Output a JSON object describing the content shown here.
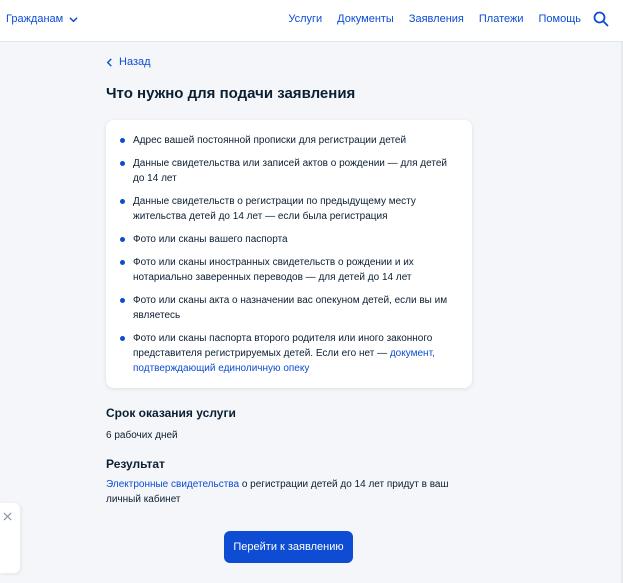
{
  "header": {
    "audience_label": "Гражданам",
    "nav": [
      "Услуги",
      "Документы",
      "Заявления",
      "Платежи",
      "Помощь"
    ],
    "search_icon": "search-icon"
  },
  "back_label": "Назад",
  "page_title": "Что нужно для подачи заявления",
  "requirements": [
    {
      "text": "Адрес вашей постоянной прописки для регистрации детей"
    },
    {
      "text": "Данные свидетельства или записей актов о рождении — для детей до 14 лет"
    },
    {
      "text": "Данные свидетельств о регистрации по предыдущему месту жительства детей до 14 лет — если была регистрация"
    },
    {
      "text": "Фото или сканы вашего паспорта"
    },
    {
      "text": "Фото или сканы иностранных свидетельств о рождении и их нотариально заверенных переводов — для детей до 14 лет"
    },
    {
      "text": "Фото или сканы акта о назначении вас опекуном детей, если вы им являетесь"
    },
    {
      "text": "Фото или сканы паспорта второго родителя или иного законного представителя регистрируемых детей. Если его нет — ",
      "link": "документ, подтверждающий единоличную опеку"
    }
  ],
  "term": {
    "title": "Срок оказания услуги",
    "value": "6 рабочих дней"
  },
  "result": {
    "title": "Результат",
    "link": "Электронные свидетельства",
    "text": " о регистрации детей до 14 лет придут в ваш личный кабинет"
  },
  "cta_label": "Перейти к заявлению",
  "colors": {
    "accent": "#0d4cd3",
    "background": "#f4f6f9",
    "text": "#0b1f33"
  }
}
